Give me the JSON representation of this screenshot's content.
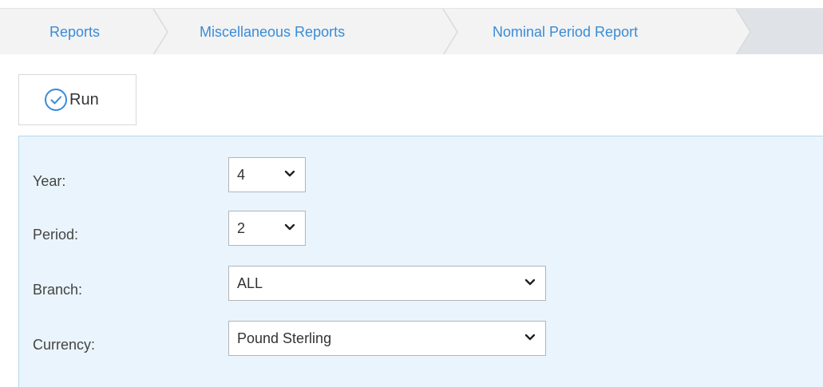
{
  "breadcrumb": {
    "items": [
      {
        "label": "Reports"
      },
      {
        "label": "Miscellaneous Reports"
      },
      {
        "label": "Nominal Period Report"
      }
    ]
  },
  "toolbar": {
    "run_label": "Run",
    "run_icon": "check-circle-icon"
  },
  "form": {
    "year": {
      "label": "Year:",
      "value": "4"
    },
    "period": {
      "label": "Period:",
      "value": "2"
    },
    "branch": {
      "label": "Branch:",
      "value": "ALL"
    },
    "currency": {
      "label": "Currency:",
      "value": "Pound Sterling"
    }
  },
  "colors": {
    "link": "#3a8bd8",
    "panel_bg": "#eaf4fc",
    "panel_border": "#b9d6ee",
    "breadcrumb_bg": "#f3f3f3"
  }
}
